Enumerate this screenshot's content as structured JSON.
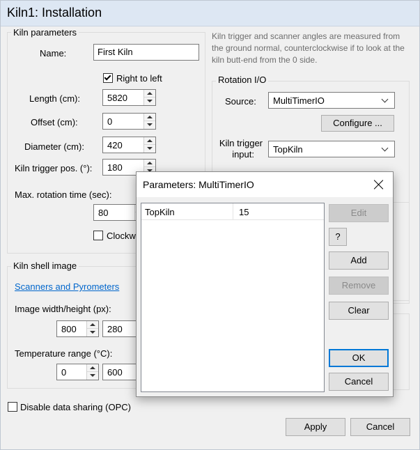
{
  "window": {
    "title": "Kiln1: Installation"
  },
  "kiln_params": {
    "group_title": "Kiln parameters",
    "name_label": "Name:",
    "name_value": "First Kiln",
    "right_to_left_label": "Right to left",
    "right_to_left_checked": true,
    "length_label": "Length (cm):",
    "length_value": "5820",
    "offset_label": "Offset (cm):",
    "offset_value": "0",
    "diameter_label": "Diameter (cm):",
    "diameter_value": "420",
    "trigger_pos_label": "Kiln trigger pos. (°):",
    "trigger_pos_value": "180",
    "max_rot_label": "Max. rotation time (sec):",
    "max_rot_value": "80",
    "clockwise_label": "Clockw",
    "clockwise_checked": false
  },
  "hint_text": "Kiln trigger and scanner angles are measured from the ground normal, counterclockwise if to look at the kiln butt-end from the 0 side.",
  "rotation_io": {
    "group_title": "Rotation I/O",
    "source_label": "Source:",
    "source_value": "MultiTimerIO",
    "configure_label": "Configure ...",
    "trigger_input_label_1": "Kiln trigger",
    "trigger_input_label_2": "input:",
    "trigger_input_value": "TopKiln"
  },
  "shell_image": {
    "group_title": "Kiln shell image",
    "link_label": "Scanners and Pyrometers",
    "size_label": "Image width/height (px):",
    "width_value": "800",
    "height_value": "280",
    "temp_label": "Temperature range (°C):",
    "temp_min_value": "0",
    "temp_max_value": "600"
  },
  "disable_sharing_label": "Disable data sharing (OPC)",
  "disable_sharing_checked": false,
  "footer": {
    "apply_label": "Apply",
    "cancel_label": "Cancel"
  },
  "dialog": {
    "title": "Parameters: MultiTimerIO",
    "rows": [
      {
        "name": "TopKiln",
        "value": "15"
      }
    ],
    "edit_label": "Edit",
    "help_label": "?",
    "add_label": "Add",
    "remove_label": "Remove",
    "clear_label": "Clear",
    "ok_label": "OK",
    "cancel_label": "Cancel"
  }
}
